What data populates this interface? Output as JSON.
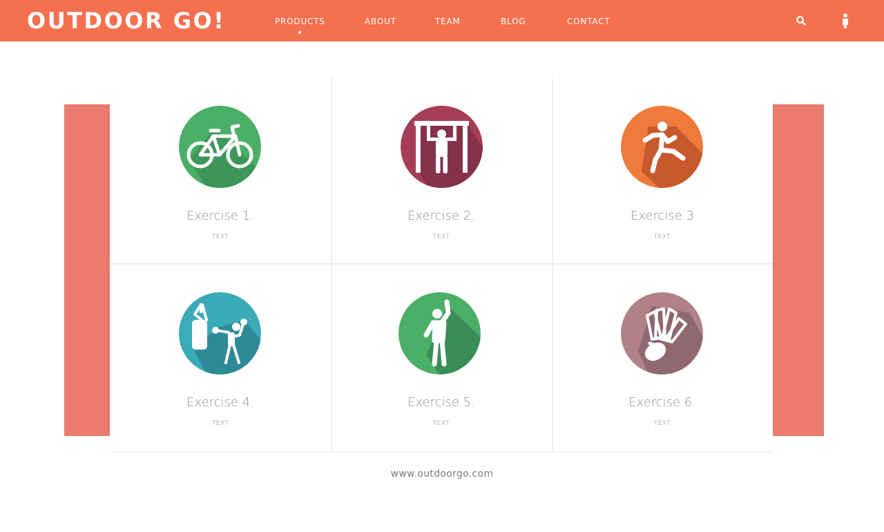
{
  "brand": {
    "logo": "OUTDOOR GO!"
  },
  "nav": {
    "items": [
      {
        "label": "PRODUCTS"
      },
      {
        "label": "ABOUT"
      },
      {
        "label": "TEAM"
      },
      {
        "label": "BLOG"
      },
      {
        "label": "CONTACT"
      }
    ],
    "active": "PRODUCTS"
  },
  "header_icons": [
    "search-icon",
    "user-icon"
  ],
  "exercises": [
    {
      "title": "Exercise 1.",
      "subtitle": "TEXT",
      "icon": "bicycle-icon",
      "color": "#4caf67"
    },
    {
      "title": "Exercise 2.",
      "subtitle": "TEXT",
      "icon": "pull-up-icon",
      "color": "#a53d55"
    },
    {
      "title": "Exercise 3",
      "subtitle": "TEXT",
      "icon": "running-icon",
      "color": "#ef7a3c"
    },
    {
      "title": "Exercise 4.",
      "subtitle": "TEXT",
      "icon": "punching-bag-icon",
      "color": "#3aabb7"
    },
    {
      "title": "Exercise 5.",
      "subtitle": "TEXT",
      "icon": "stretching-icon",
      "color": "#4caf67"
    },
    {
      "title": "Exercise 6.",
      "subtitle": "TEXT",
      "icon": "shuttlecock-icon",
      "color": "#b08288"
    }
  ],
  "footer": {
    "url": "www.outdoorgo.com"
  },
  "colors": {
    "brand": "#f4704f",
    "panel": "#ea7b6e"
  }
}
